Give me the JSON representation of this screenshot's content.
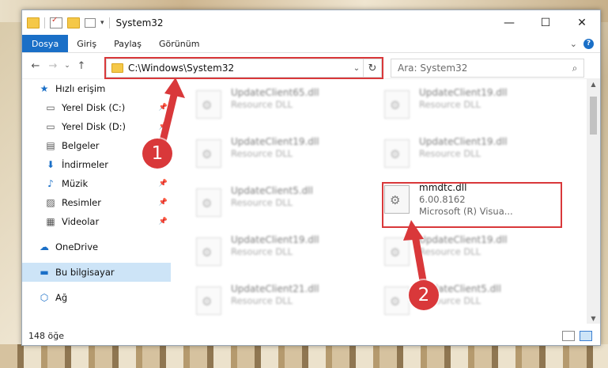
{
  "window": {
    "title": "System32"
  },
  "controls": {
    "minimize": "—",
    "maximize": "☐",
    "close": "✕"
  },
  "ribbon": {
    "tabs": [
      "Dosya",
      "Giriş",
      "Paylaş",
      "Görünüm"
    ],
    "expand": "⌄",
    "help": "?"
  },
  "nav": {
    "back": "←",
    "forward": "→",
    "recent": "⌄",
    "up": "↑"
  },
  "address": {
    "path": "C:\\Windows\\System32",
    "dropdown": "⌄",
    "refresh": "↻"
  },
  "search": {
    "placeholder": "Ara: System32",
    "icon": "⌕"
  },
  "sidebar": [
    {
      "label": "Hızlı erişim",
      "icon": "★"
    },
    {
      "label": "Yerel Disk (C:)",
      "icon": "▭",
      "pinned": true
    },
    {
      "label": "Yerel Disk (D:)",
      "icon": "▭",
      "pinned": true
    },
    {
      "label": "Belgeler",
      "icon": "▤",
      "pinned": true
    },
    {
      "label": "İndirmeler",
      "icon": "⬇",
      "pinned": true
    },
    {
      "label": "Müzik",
      "icon": "♪",
      "pinned": true
    },
    {
      "label": "Resimler",
      "icon": "▨",
      "pinned": true
    },
    {
      "label": "Videolar",
      "icon": "▦",
      "pinned": true
    },
    {
      "label": "OneDrive",
      "icon": "☁"
    },
    {
      "label": "Bu bilgisayar",
      "icon": "▬"
    },
    {
      "label": "Ağ",
      "icon": "⬡"
    }
  ],
  "files": [
    {
      "name": "UpdateClient65.dll",
      "desc": "Resource DLL"
    },
    {
      "name": "UpdateClient19.dll",
      "desc": "Resource DLL"
    },
    {
      "name": "UpdateClient19.dll",
      "desc": "Resource DLL"
    },
    {
      "name": "UpdateClient19.dll",
      "desc": "Resource DLL"
    },
    {
      "name": "UpdateClient5.dll",
      "desc": "Resource DLL"
    },
    {
      "name": "mmdtc.dll",
      "version": "6.00.8162",
      "desc": "Microsoft (R) Visua..."
    },
    {
      "name": "UpdateClient19.dll",
      "desc": "Resource DLL"
    },
    {
      "name": "UpdateClient19.dll",
      "desc": "Resource DLL"
    },
    {
      "name": "UpdateClient21.dll",
      "desc": "Resource DLL"
    },
    {
      "name": "UpdateClient5.dll",
      "desc": "Resource DLL"
    }
  ],
  "status": {
    "count": "148 öğe"
  },
  "annotations": {
    "badge1": "1",
    "badge2": "2",
    "accent": "#d9383a"
  },
  "scrollbar": {
    "up": "▲",
    "down": "▼"
  }
}
